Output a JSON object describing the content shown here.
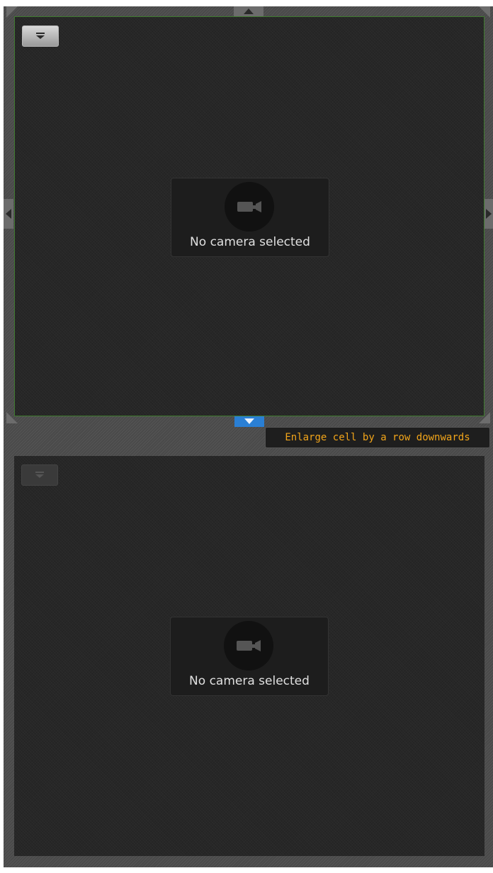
{
  "cells": [
    {
      "state": "selected",
      "menu_icon": "menu-dropdown-icon",
      "camera_icon": "video-camera-icon",
      "placeholder_text": "No camera selected"
    },
    {
      "state": "unselected",
      "menu_icon": "menu-dropdown-icon",
      "camera_icon": "video-camera-icon",
      "placeholder_text": "No camera selected"
    }
  ],
  "tooltip": {
    "text": "Enlarge cell by a row downwards"
  },
  "colors": {
    "selected_border": "#3e7a2e",
    "tooltip_text": "#f2a51a",
    "active_handle": "#2a7fd4"
  }
}
